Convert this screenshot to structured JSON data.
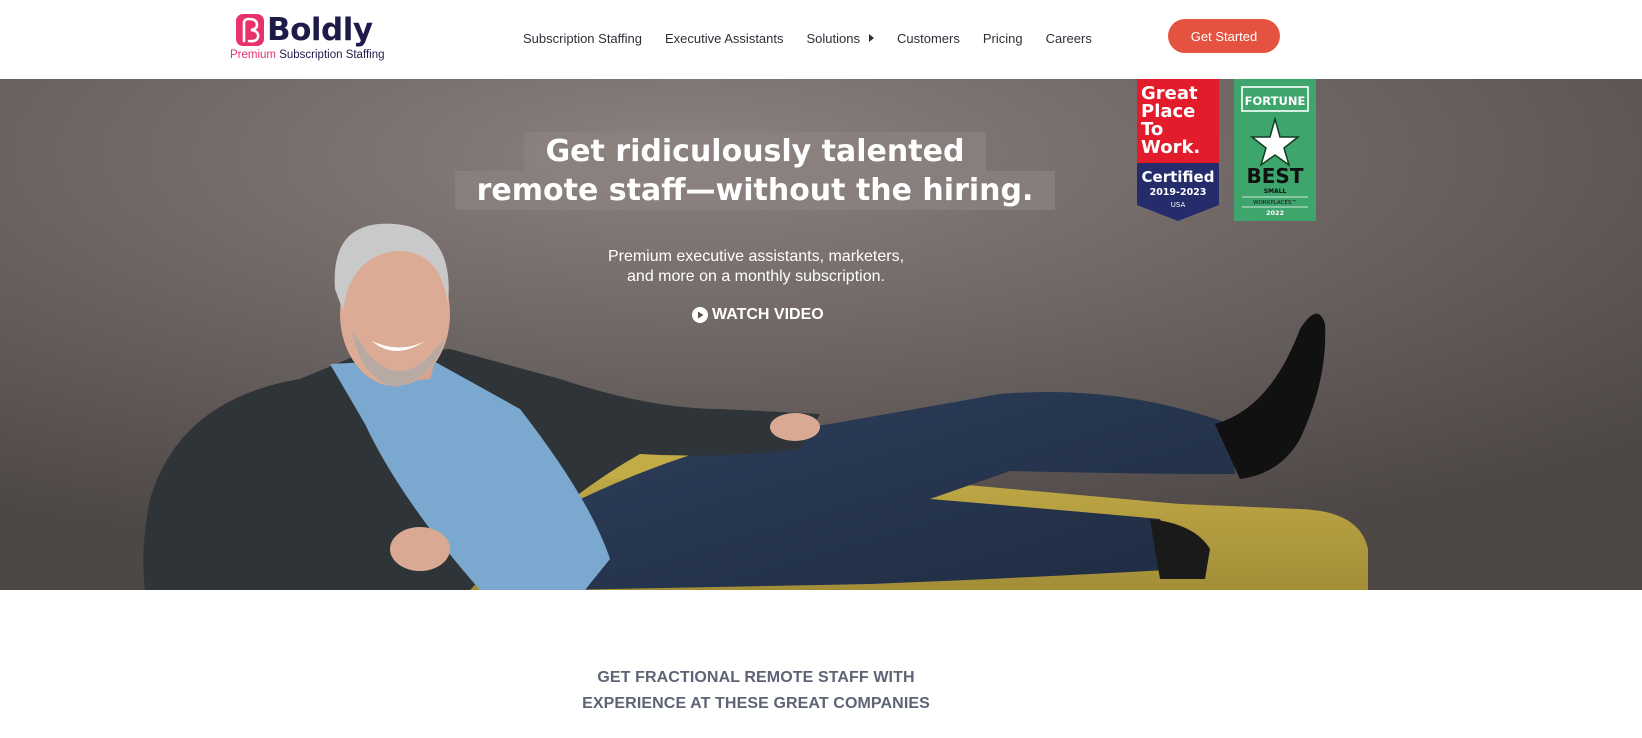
{
  "brand": {
    "name": "Boldly",
    "tagline_accent": "Premium",
    "tagline_rest": " Subscription Staffing",
    "colors": {
      "navy": "#1e1b4b",
      "pink": "#e8326b",
      "cta": "#e5523f"
    }
  },
  "nav": {
    "items": [
      {
        "label": "Subscription Staffing"
      },
      {
        "label": "Executive Assistants"
      },
      {
        "label": "Solutions",
        "has_dropdown": true
      },
      {
        "label": "Customers"
      },
      {
        "label": "Pricing"
      },
      {
        "label": "Careers"
      }
    ],
    "cta_label": "Get Started"
  },
  "hero": {
    "headline_line1": "Get ridiculously talented",
    "headline_line2": "remote staff—without the hiring.",
    "subtext_line1": "Premium executive assistants, marketers,",
    "subtext_line2": "and more on a monthly subscription.",
    "watch_label": "WATCH VIDEO",
    "watch_icon": "play-circle-icon"
  },
  "badges": {
    "gptw": {
      "line1": "Great",
      "line2": "Place",
      "line3": "To",
      "line4": "Work.",
      "certified": "Certified",
      "years": "2019-2023",
      "country": "USA"
    },
    "fortune": {
      "title": "FORTUNE",
      "best": "BEST",
      "small": "SMALL",
      "workplaces": "WORKPLACES™",
      "year": "2022"
    }
  },
  "clients": {
    "heading_line1": "GET FRACTIONAL REMOTE STAFF WITH",
    "heading_line2": "EXPERIENCE AT THESE GREAT COMPANIES"
  }
}
